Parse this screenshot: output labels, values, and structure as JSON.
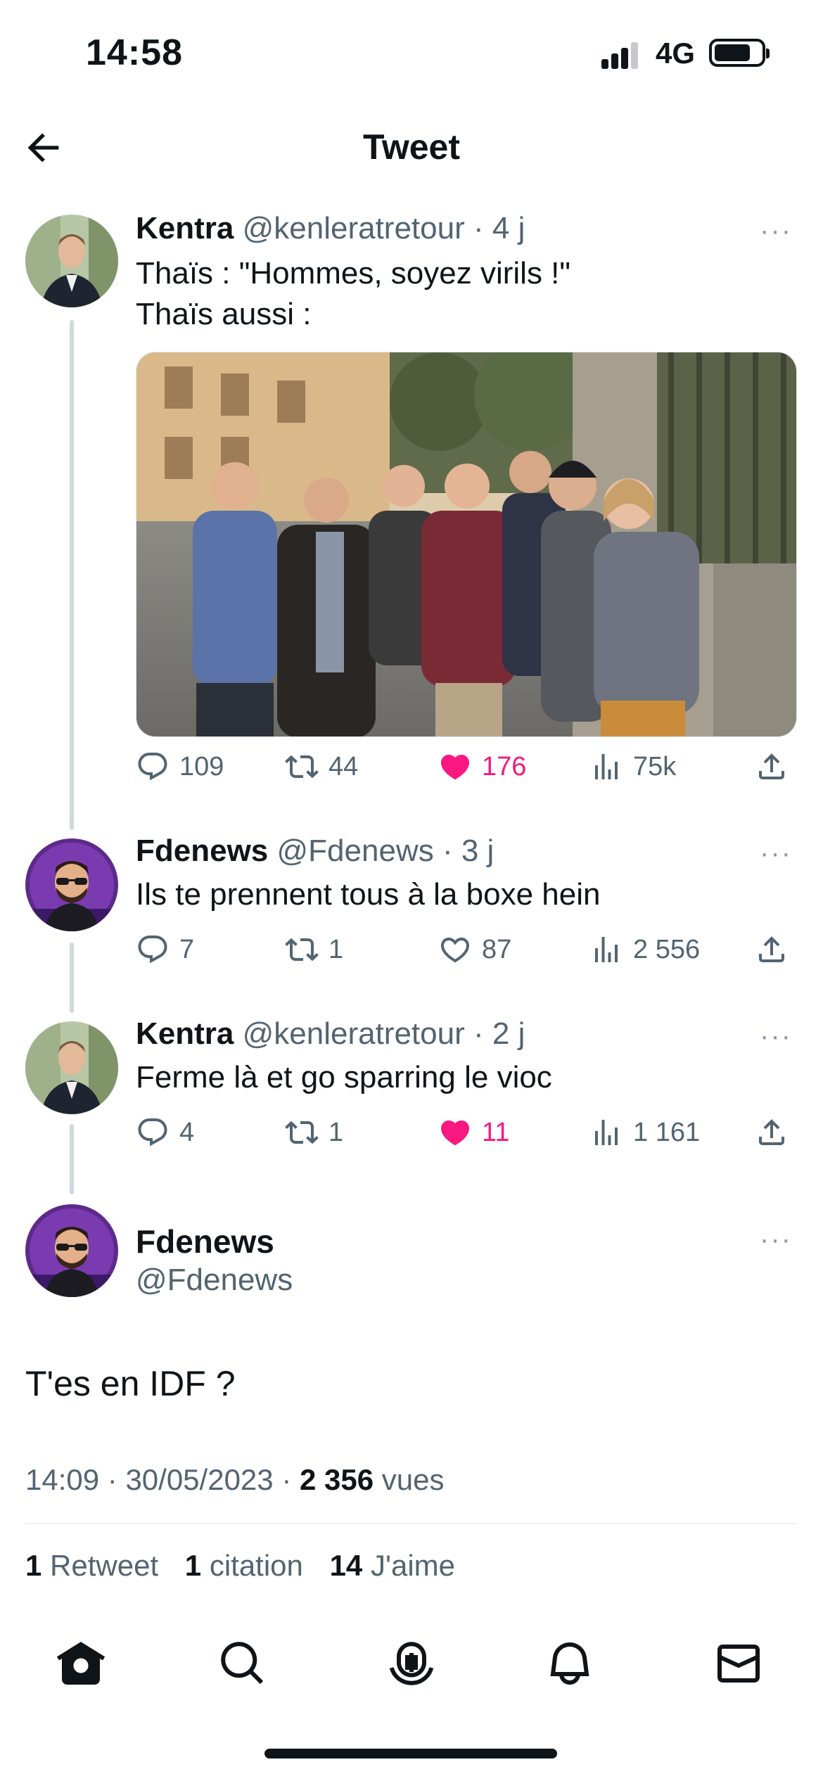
{
  "status_bar": {
    "time": "14:58",
    "network": "4G",
    "battery_level": 0.78,
    "signal_bars": 3
  },
  "header": {
    "title": "Tweet"
  },
  "colors": {
    "like": "#f91880",
    "muted": "#536471",
    "line": "#cfd9de"
  },
  "thread": [
    {
      "name": "Kentra",
      "handle": "@kenleratretour",
      "time": "· 4 j",
      "text_lines": [
        "Thaïs : \"Hommes, soyez virils !\"",
        "Thaïs aussi :"
      ],
      "has_media": true,
      "replies": "109",
      "retweets": "44",
      "likes": "176",
      "liked": true,
      "views": "75k"
    },
    {
      "name": "Fdenews",
      "handle": "@Fdenews",
      "time": "· 3 j",
      "text_lines": [
        "Ils te prennent tous à la boxe hein"
      ],
      "replies": "7",
      "retweets": "1",
      "likes": "87",
      "liked": false,
      "views": "2 556"
    },
    {
      "name": "Kentra",
      "handle": "@kenleratretour",
      "time": "· 2 j",
      "text_lines": [
        "Ferme là et go sparring le vioc"
      ],
      "replies": "4",
      "retweets": "1",
      "likes": "11",
      "liked": true,
      "views": "1 161"
    }
  ],
  "main_tweet": {
    "name": "Fdenews",
    "handle": "@Fdenews",
    "text": "T'es en IDF ?",
    "time": "14:09",
    "date": "30/05/2023",
    "views_count": "2 356",
    "views_label": "vues",
    "retweets_count": "1",
    "retweets_label": "Retweet",
    "quotes_count": "1",
    "quotes_label": "citation",
    "likes_count": "14",
    "likes_label": "J'aime"
  },
  "more_label": "···",
  "tab_bar": [
    "home-icon",
    "search-icon",
    "spaces-icon",
    "notifications-icon",
    "messages-icon"
  ]
}
